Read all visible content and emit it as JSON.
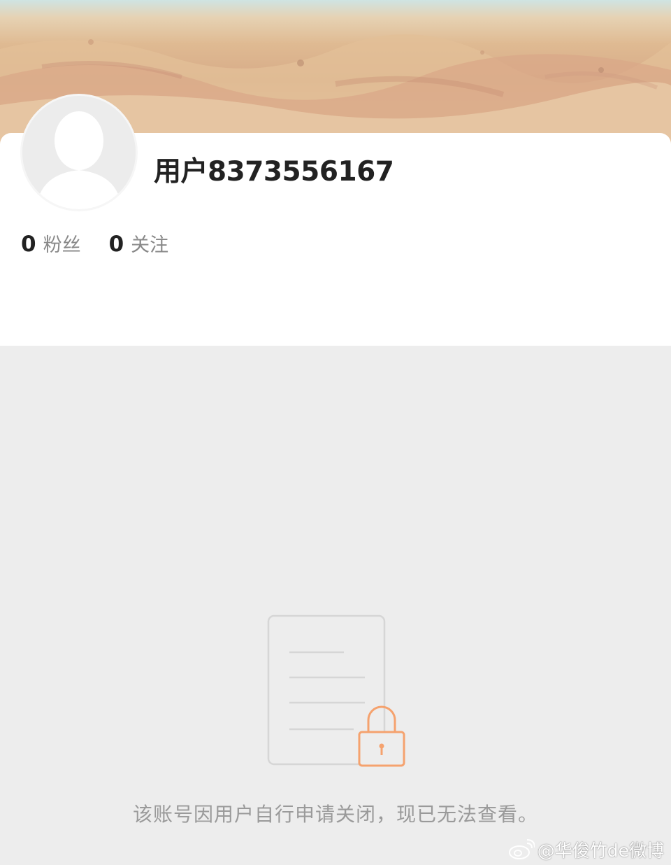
{
  "profile": {
    "username": "用户8373556167",
    "stats": [
      {
        "count": "0",
        "label": "粉丝"
      },
      {
        "count": "0",
        "label": "关注"
      }
    ]
  },
  "notice": {
    "text": "该账号因用户自行申请关闭，现已无法查看。"
  },
  "watermark": {
    "text": "@华俊竹de微博"
  },
  "icons": {
    "avatar": "default-avatar-silhouette",
    "locked": "locked-document-icon",
    "watermark_logo": "weibo-logo-icon"
  },
  "colors": {
    "page_background": "#ededed",
    "card_background": "#ffffff",
    "lock_accent": "#f5a26e",
    "notice_text": "#9a9a9a",
    "username_text": "#222222"
  }
}
